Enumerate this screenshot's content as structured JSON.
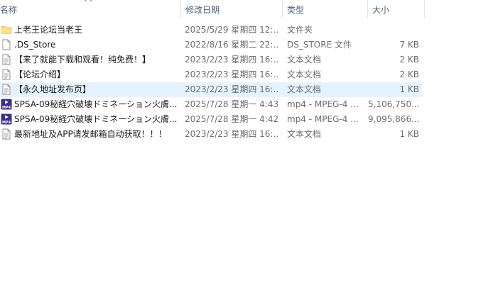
{
  "columns": {
    "name": "名称",
    "date": "修改日期",
    "type": "类型",
    "size": "大小"
  },
  "files": [
    {
      "icon": "folder-icon",
      "name": "上老王论坛当老王",
      "date": "2025/5/29 星期四 12:...",
      "type": "文件夹",
      "size": "",
      "selected": false
    },
    {
      "icon": "file-icon",
      "name": ".DS_Store",
      "date": "2022/8/16 星期二 22:...",
      "type": "DS_STORE 文件",
      "size": "7 KB",
      "selected": false
    },
    {
      "icon": "text-file-icon",
      "name": "【来了就能下载和观看！纯免费！】",
      "date": "2023/2/23 星期四 16:...",
      "type": "文本文档",
      "size": "2 KB",
      "selected": false
    },
    {
      "icon": "text-file-icon",
      "name": "【论坛介绍】",
      "date": "2023/2/23 星期四 16:...",
      "type": "文本文档",
      "size": "2 KB",
      "selected": false
    },
    {
      "icon": "text-file-icon",
      "name": "【永久地址发布页】",
      "date": "2023/2/23 星期四 16:...",
      "type": "文本文档",
      "size": "1 KB",
      "selected": true
    },
    {
      "icon": "mp4-video-icon",
      "name": "SPSA-09秘経穴破壊ドミネーション火膚...",
      "date": "2025/7/28 星期一 4:43",
      "type": "mp4 - MPEG-4 ...",
      "size": "5,106,750...",
      "selected": false
    },
    {
      "icon": "mp4-video-icon",
      "name": "SPSA-09秘経穴破壊ドミネーション火膚...",
      "date": "2025/7/28 星期一 4:42",
      "type": "mp4 - MPEG-4 ...",
      "size": "9,095,866...",
      "selected": false
    },
    {
      "icon": "text-file-icon",
      "name": "最新地址及APP请发邮箱自动获取！！！",
      "date": "2023/2/23 星期四 16:...",
      "type": "文本文档",
      "size": "1 KB",
      "selected": false
    }
  ]
}
